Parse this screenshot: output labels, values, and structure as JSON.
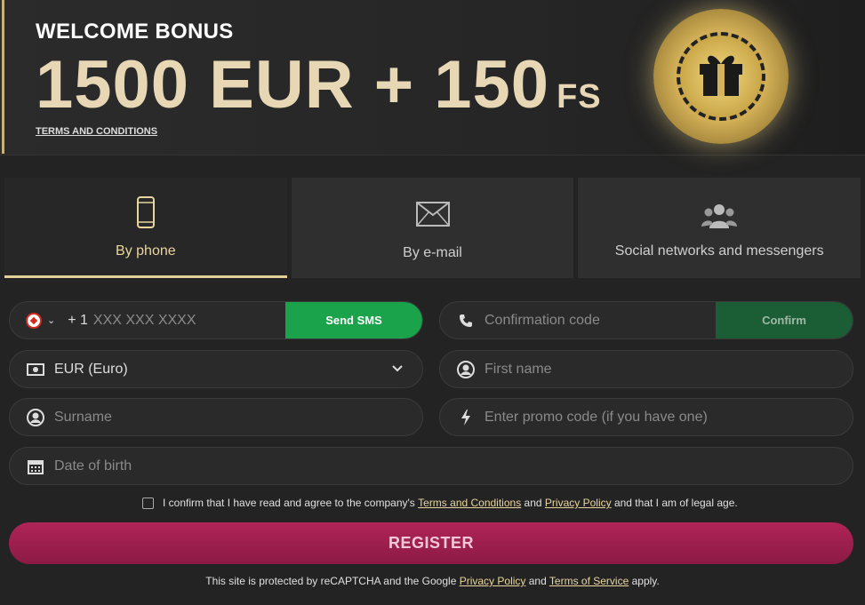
{
  "banner": {
    "welcome": "WELCOME BONUS",
    "amount": "1500 EUR + 150",
    "amount_suffix": "FS",
    "terms_link": "TERMS AND CONDITIONS"
  },
  "tabs": [
    {
      "label": "By phone",
      "icon": "smartphone-icon",
      "active": true
    },
    {
      "label": "By e-mail",
      "icon": "envelope-icon",
      "active": false
    },
    {
      "label": "Social networks and messengers",
      "icon": "users-icon",
      "active": false
    }
  ],
  "form": {
    "phone_prefix": "+ 1",
    "phone_placeholder": "XXX XXX XXXX",
    "send_sms": "Send SMS",
    "confirmation_placeholder": "Confirmation code",
    "confirm": "Confirm",
    "currency_value": "EUR (Euro)",
    "first_name_placeholder": "First name",
    "surname_placeholder": "Surname",
    "promo_placeholder": "Enter promo code (if you have one)",
    "dob_placeholder": "Date of birth"
  },
  "agreement": {
    "text_1": "I confirm that I have read and agree to the company's",
    "terms_link": "Terms and Conditions",
    "and": "and",
    "privacy_link": "Privacy Policy",
    "text_2": "and that I am of legal age."
  },
  "register": "REGISTER",
  "captcha": {
    "text_1": "This site is protected by reCAPTCHA and the Google",
    "privacy_link": "Privacy Policy",
    "and": "and",
    "terms_link": "Terms of Service",
    "text_2": "apply."
  },
  "colors": {
    "accent_gold": "#e2cf9a",
    "green": "#1aa34a",
    "register": "#b02457"
  }
}
